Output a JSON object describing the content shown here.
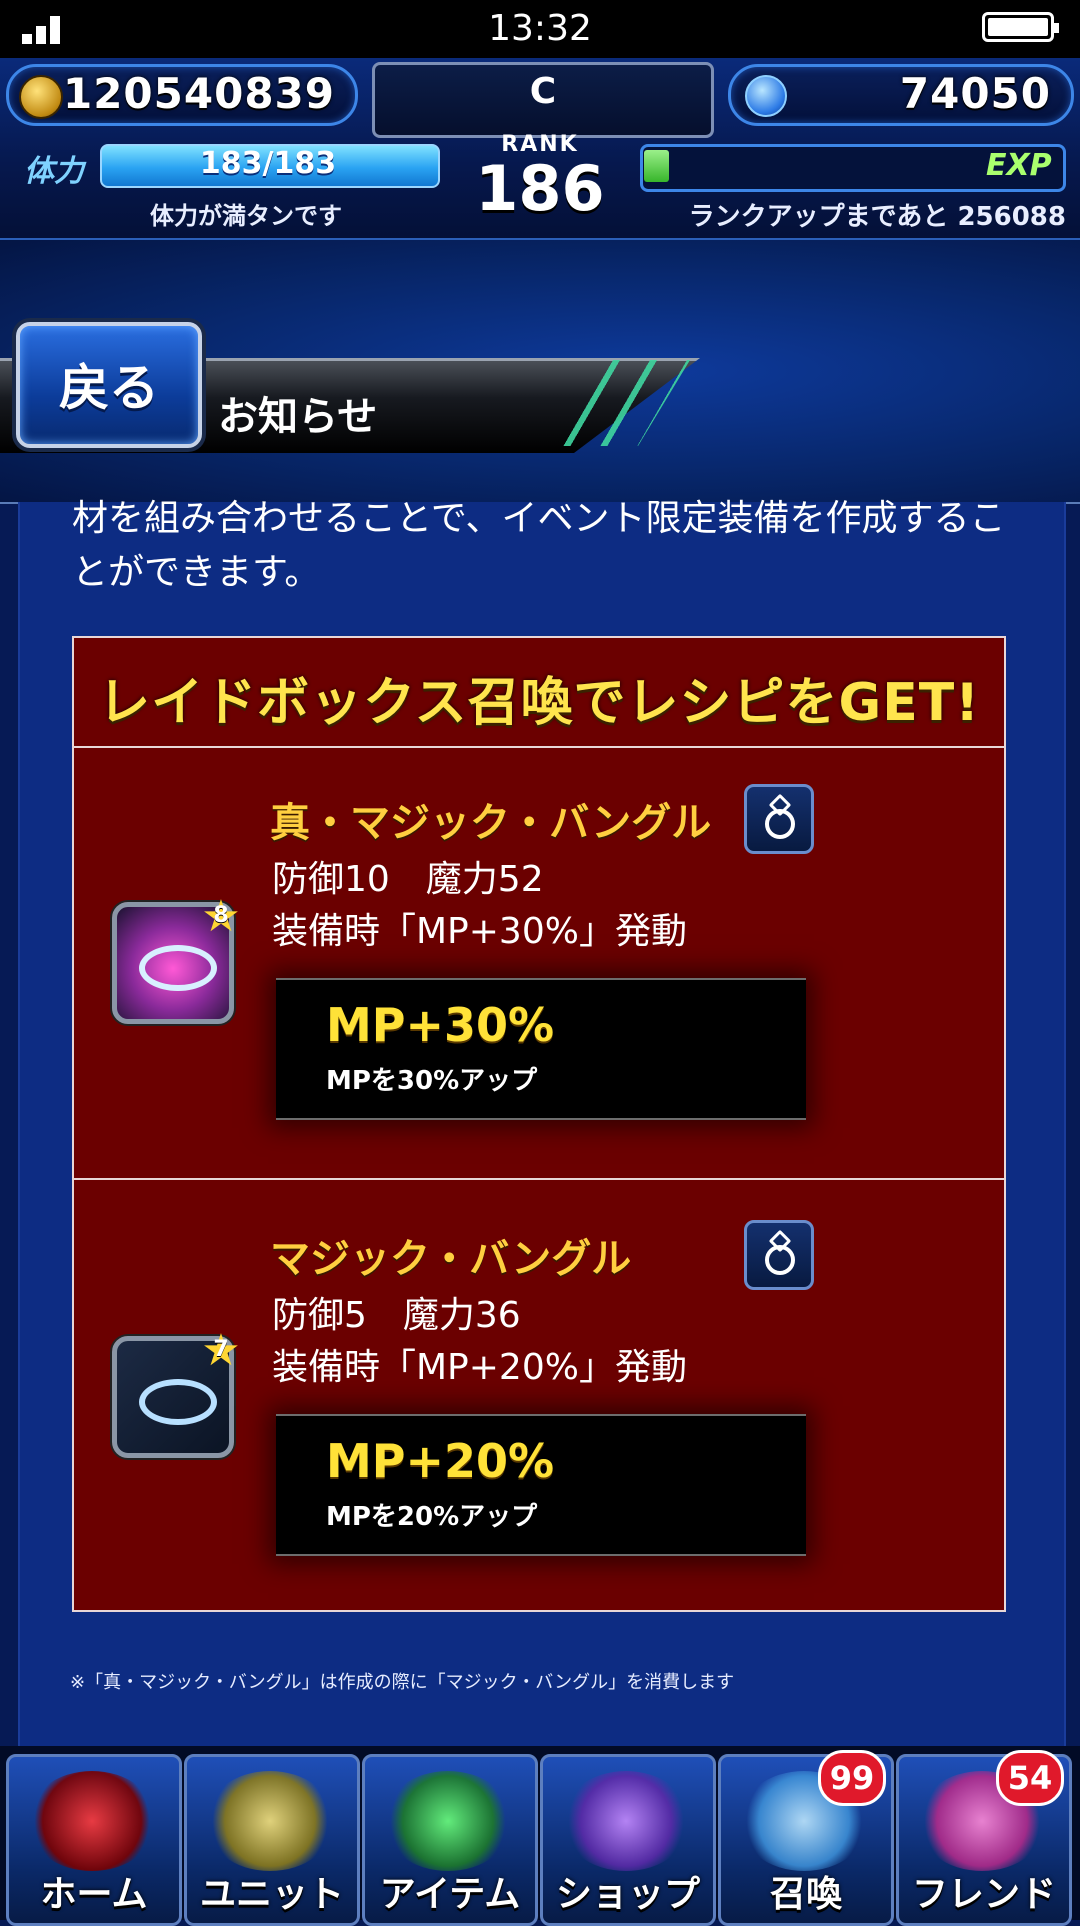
{
  "status_bar": {
    "time": "13:32"
  },
  "header": {
    "gil": "120540839",
    "gems": "74050",
    "rank_letter": "C",
    "rank_label": "RANK",
    "rank_value": "186",
    "stamina_label": "体力",
    "stamina_value": "183/183",
    "stamina_note": "体力が満タンです",
    "exp_label": "EXP",
    "exp_progress": 0.06,
    "exp_note": "ランクアップまであと 256088"
  },
  "nav": {
    "back_label": "戻る",
    "page_title": "お知らせ"
  },
  "content": {
    "intro": "材を組み合わせることで、イベント限定装備を作成することができます。",
    "recipe_heading": "レイドボックス召喚でレシピをGET!",
    "items": [
      {
        "name": "真・マジック・バングル",
        "rarity": "8",
        "stats": "防御10　魔力52",
        "effect": "装備時「MP+30%」発動",
        "ability_name": "MP+30%",
        "ability_desc": "MPを30%アップ",
        "icon": "magenta-bangle-icon"
      },
      {
        "name": "マジック・バングル",
        "rarity": "7",
        "stats": "防御5　魔力36",
        "effect": "装備時「MP+20%」発動",
        "ability_name": "MP+20%",
        "ability_desc": "MPを20%アップ",
        "icon": "blue-bangle-icon"
      }
    ],
    "footnote": "※「真・マジック・バングル」は作成の際に「マジック・バングル」を消費します"
  },
  "bottom_nav": [
    {
      "label": "ホーム",
      "badge": ""
    },
    {
      "label": "ユニット",
      "badge": ""
    },
    {
      "label": "アイテム",
      "badge": ""
    },
    {
      "label": "ショップ",
      "badge": ""
    },
    {
      "label": "召喚",
      "badge": "99"
    },
    {
      "label": "フレンド",
      "badge": "54"
    }
  ],
  "colors": {
    "accent_gold": "#ffe238",
    "panel_red": "#6b0000",
    "bg_blue": "#0d2c83"
  }
}
